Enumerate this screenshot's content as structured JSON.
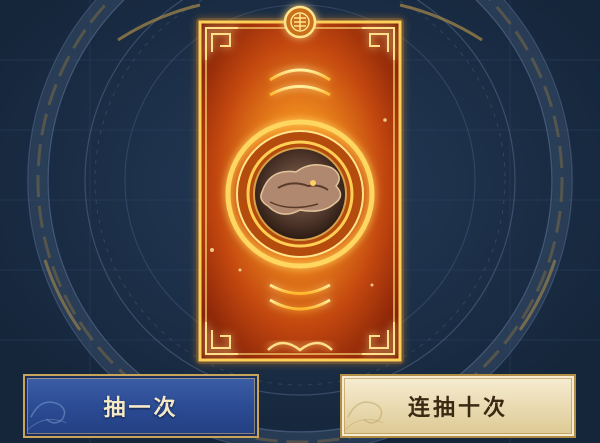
{
  "draw_panel": {
    "single_draw_label": "抽一次",
    "ten_draw_label": "连抽十次"
  },
  "colors": {
    "background": "#1a2d45",
    "card_gold": "#ffb32a",
    "card_red": "#b0310e",
    "single_button": "#2a4a92",
    "ten_button": "#e9d9af"
  }
}
